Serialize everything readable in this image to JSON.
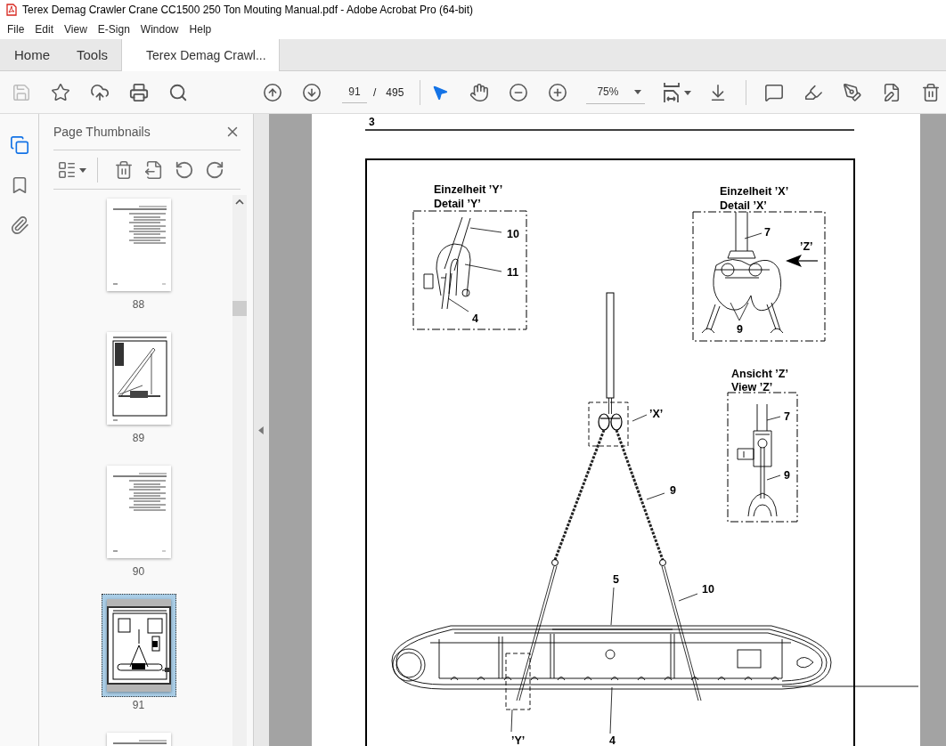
{
  "window": {
    "title": "Terex Demag Crawler Crane CC1500 250 Ton Mouting Manual.pdf - Adobe Acrobat Pro (64-bit)"
  },
  "menu": [
    "File",
    "Edit",
    "View",
    "E-Sign",
    "Window",
    "Help"
  ],
  "tabs": [
    {
      "label": "Home",
      "selected": false
    },
    {
      "label": "Tools",
      "selected": false
    },
    {
      "label": "Terex Demag Crawl...",
      "selected": true
    }
  ],
  "toolbar": {
    "page_current": "91",
    "page_separator": "/",
    "page_total": "495",
    "zoom": "75%"
  },
  "rail": [
    {
      "kind": "pages",
      "selected": true
    },
    {
      "kind": "bookmarks",
      "selected": false
    },
    {
      "kind": "attachments",
      "selected": false
    }
  ],
  "sidebar": {
    "title": "Page Thumbnails",
    "thumbnails": [
      {
        "label": "88",
        "kind": "text",
        "selected": false
      },
      {
        "label": "89",
        "kind": "figure",
        "selected": false
      },
      {
        "label": "90",
        "kind": "text",
        "selected": false
      },
      {
        "label": "91",
        "kind": "diagram",
        "selected": true
      },
      {
        "kind": "text",
        "selected": false
      }
    ]
  },
  "document": {
    "section": "3",
    "labels": [
      "Einzelheit ’Y’",
      "Detail ’Y’",
      "Einzelheit ’X’",
      "Detail ’X’",
      "10",
      "7",
      "’Z’",
      "11",
      "4",
      "9",
      "Ansicht ’Z’",
      "View ’Z’",
      "’X’",
      "7",
      "9",
      "9",
      "5",
      "10",
      "’Y’",
      "4"
    ]
  }
}
